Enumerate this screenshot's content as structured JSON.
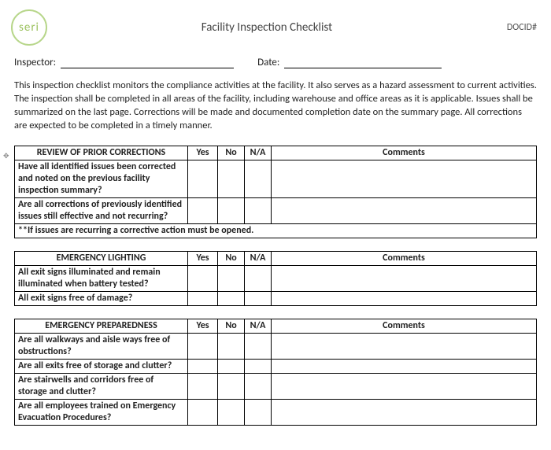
{
  "header": {
    "logo_text": "seri",
    "title": "Facility Inspection Checklist",
    "docid_label": "DOCID#"
  },
  "form": {
    "inspector_label": "Inspector:",
    "date_label": "Date:"
  },
  "intro": "This inspection checklist monitors the compliance activities at the facility.  It also serves as a hazard assessment to current activities.  The inspection shall be completed in all areas of the facility, including warehouse and office areas as it is applicable.  Issues shall be summarized on the last page.  Corrections will be made and documented completion date on the summary page.   All corrections are expected to be completed in a timely manner.",
  "columns": {
    "yes": "Yes",
    "no": "No",
    "na": "N/A",
    "comments": "Comments"
  },
  "sections": [
    {
      "title": "REVIEW OF PRIOR CORRECTIONS",
      "rows": [
        "Have all identified issues been corrected and noted on the previous facility inspection summary?",
        "Are all corrections of previously identified issues still effective and not recurring?"
      ],
      "note": "**If issues are recurring a corrective action must be opened."
    },
    {
      "title": "EMERGENCY LIGHTING",
      "rows": [
        "All exit signs illuminated and remain illuminated when battery tested?",
        "All exit signs free of damage?"
      ]
    },
    {
      "title": "EMERGENCY PREPAREDNESS",
      "rows": [
        "Are all walkways and aisle ways free of obstructions?",
        "Are all exits free of storage and clutter?",
        "Are stairwells and corridors free of storage and clutter?",
        "Are all employees trained on Emergency Evacuation Procedures?"
      ]
    }
  ]
}
